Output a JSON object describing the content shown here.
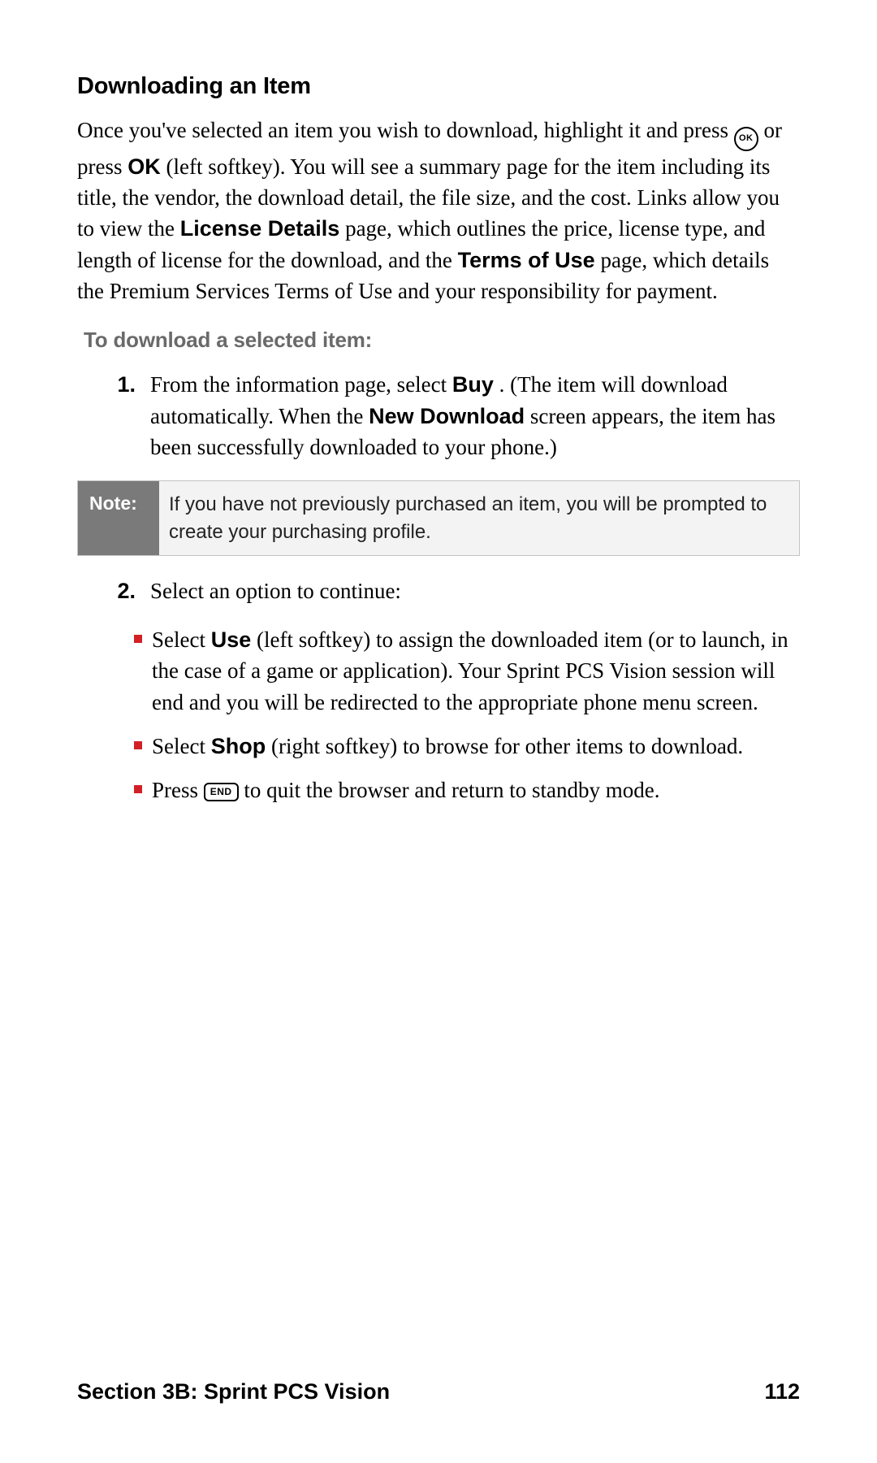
{
  "heading": "Downloading an Item",
  "intro": {
    "p1a": "Once you've selected an item you wish to download, highlight it and press ",
    "ok_icon_label": "OK",
    "p1b": " or press ",
    "ok_bold": "OK",
    "p1c": " (left softkey). You will see a summary page for the item including its title, the vendor, the download detail, the file size, and the cost. Links allow you to view the ",
    "license_bold": "License Details",
    "p1d": " page, which outlines the price, license type, and length of license for the download, and the ",
    "terms_bold": "Terms of Use",
    "p1e": " page, which details the Premium Services Terms of Use and your responsibility for payment."
  },
  "subheading": "To download a selected item:",
  "steps": {
    "s1": {
      "num": "1.",
      "a": "From the information page, select ",
      "buy_bold": "Buy",
      "b": ". (The item will download automatically. When the ",
      "newdl_bold": "New Download",
      "c": " screen appears, the item has been successfully downloaded to your phone.)"
    },
    "s2": {
      "num": "2.",
      "text": "Select an option to continue:"
    }
  },
  "note": {
    "label": "Note:",
    "text": "If you have not previously purchased an item, you will be prompted to create your purchasing profile."
  },
  "bullets": {
    "b1": {
      "a": "Select ",
      "use_bold": "Use",
      "b": " (left softkey) to assign the downloaded item (or to launch, in the case of a game or application). Your Sprint PCS Vision session will end and you will be redirected to the appropriate phone menu screen."
    },
    "b2": {
      "a": "Select ",
      "shop_bold": "Shop",
      "b": " (right softkey) to browse for other items to download."
    },
    "b3": {
      "a": "Press ",
      "end_key_label": "END",
      "b": " to quit the browser and return to standby mode."
    }
  },
  "footer": {
    "left": "Section 3B: Sprint PCS Vision",
    "right": "112"
  }
}
